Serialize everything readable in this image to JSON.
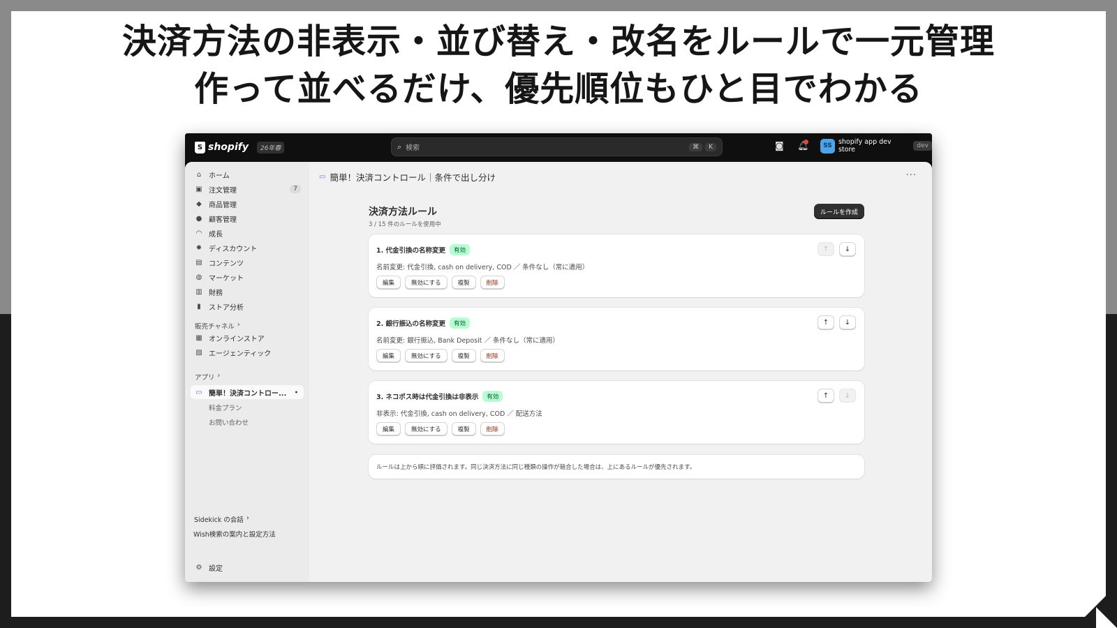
{
  "headline": {
    "line1": "決済方法の非表示・並び替え・改名をルールで一元管理",
    "line2": "作って並べるだけ、優先順位もひと目でわかる"
  },
  "topbar": {
    "logo_text": "shopify",
    "logo_badge": "26年春",
    "search_placeholder": "検索",
    "search_kbd": [
      "⌘",
      "K"
    ],
    "notification_count": "1",
    "avatar_initials": "SS",
    "store_name": "shopify app dev store",
    "store_badge": "dev"
  },
  "sidebar": {
    "items": [
      {
        "label": "ホーム",
        "icon": "home-icon"
      },
      {
        "label": "注文管理",
        "icon": "inbox-icon",
        "count": "7"
      },
      {
        "label": "商品管理",
        "icon": "tag-icon"
      },
      {
        "label": "顧客管理",
        "icon": "person-icon"
      },
      {
        "label": "成長",
        "icon": "gauge-icon"
      },
      {
        "label": "ディスカウント",
        "icon": "discount-icon"
      },
      {
        "label": "コンテンツ",
        "icon": "content-icon"
      },
      {
        "label": "マーケット",
        "icon": "globe-icon"
      },
      {
        "label": "財務",
        "icon": "bank-icon"
      },
      {
        "label": "ストア分析",
        "icon": "chart-icon"
      }
    ],
    "sales_channels_label": "販売チャネル",
    "channels": [
      {
        "label": "オンラインストア",
        "icon": "store-icon"
      },
      {
        "label": "エージェンティック",
        "icon": "agentic-icon"
      }
    ],
    "apps_label": "アプリ",
    "app_active": "簡単！決済コントロー...",
    "app_sub": [
      "料金プラン",
      "お問い合わせ"
    ],
    "sidekick_label": "Sidekick の会話",
    "wish_label": "Wish検索の案内と設定方法",
    "settings_label": "設定"
  },
  "main": {
    "page_title": "簡単！決済コントロール｜条件で出し分け",
    "rules_title": "決済方法ルール",
    "rules_sub": "3 / 15 件のルールを使用中",
    "create_button": "ルールを作成",
    "status_label": "有効",
    "action_labels": {
      "edit": "編集",
      "disable": "無効にする",
      "duplicate": "複製",
      "delete": "削除"
    },
    "rules": [
      {
        "title": "1. 代金引換の名称変更",
        "desc": "名前変更: 代金引換, cash on delivery, COD ／ 条件なし（常に適用）"
      },
      {
        "title": "2. 銀行振込の名称変更",
        "desc": "名前変更: 銀行振込, Bank Deposit ／ 条件なし（常に適用）"
      },
      {
        "title": "3. ネコポス時は代金引換は非表示",
        "desc": "非表示: 代金引換, cash on delivery, COD ／ 配送方法"
      }
    ],
    "note": "ルールは上から順に評価されます。同じ決済方法に同じ種類の操作が競合した場合は、上にあるルールが優先されます。"
  },
  "colors": {
    "accent_dark": "#303030",
    "badge_green_bg": "#b4fed2",
    "danger_text": "#8e1f0b",
    "avatar_blue": "#4ea4e6"
  }
}
